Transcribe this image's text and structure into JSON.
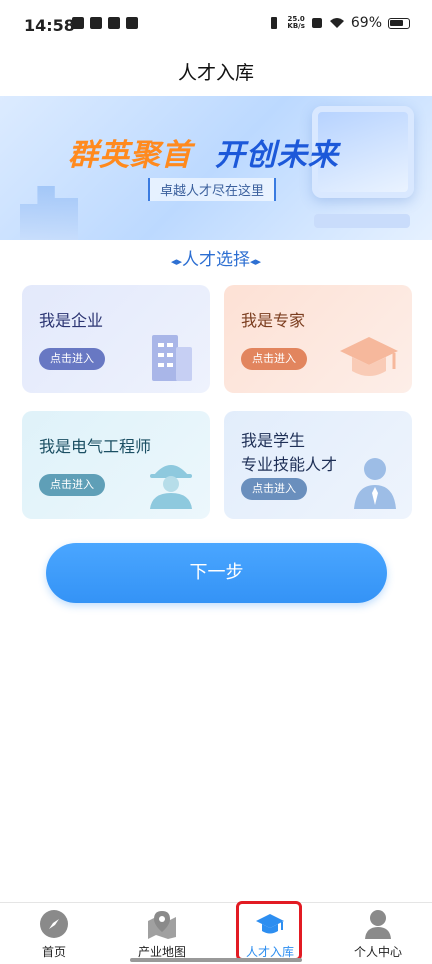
{
  "status_bar": {
    "time": "14:58",
    "speed_value": "25.0",
    "speed_unit": "KB/s",
    "battery": "69%"
  },
  "header": {
    "title": "人才入库"
  },
  "banner": {
    "slogan_part1": "群英聚首",
    "slogan_part2": "开创未来",
    "subtitle": "卓越人才尽在这里"
  },
  "section": {
    "title": "人才选择"
  },
  "cards": [
    {
      "label": "我是企业",
      "button": "点击进入",
      "icon": "building-icon"
    },
    {
      "label": "我是专家",
      "button": "点击进入",
      "icon": "graduation-cap-icon"
    },
    {
      "label": "我是电气工程师",
      "button": "点击进入",
      "icon": "engineer-icon"
    },
    {
      "label_line1": "我是学生",
      "label_line2": "专业技能人才",
      "button": "点击进入",
      "icon": "student-icon"
    }
  ],
  "next_button": "下一步",
  "tabbar": {
    "items": [
      {
        "label": "首页",
        "icon": "compass-icon"
      },
      {
        "label": "产业地图",
        "icon": "map-pin-icon"
      },
      {
        "label": "人才入库",
        "icon": "graduation-cap-icon",
        "active": true
      },
      {
        "label": "个人中心",
        "icon": "person-icon"
      }
    ]
  },
  "colors": {
    "accent": "#3493f6",
    "highlight": "#e21b23"
  }
}
